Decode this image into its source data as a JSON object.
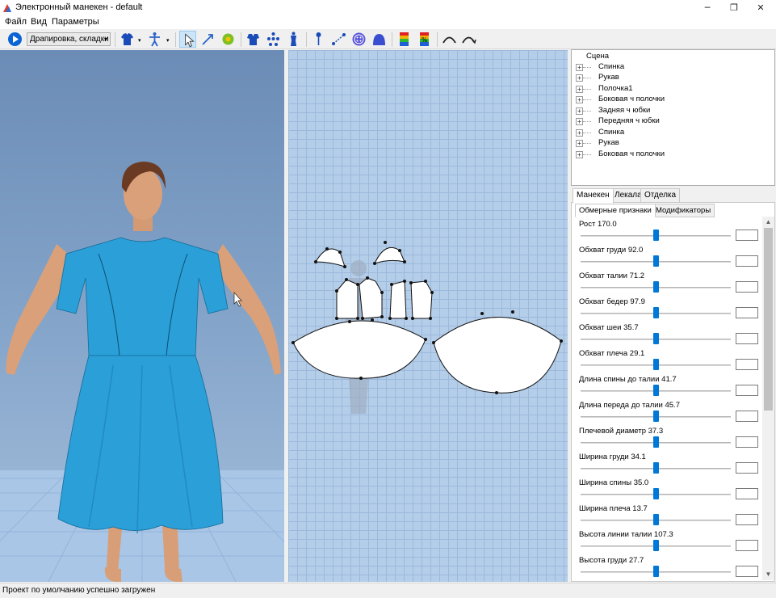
{
  "window": {
    "title": "Электронный манекен - default",
    "minimize_glyph": "─",
    "maximize_glyph": "❐",
    "close_glyph": "✕"
  },
  "menu": [
    "Файл",
    "Вид",
    "Параметры"
  ],
  "toolbar": {
    "mode_select_value": "Драпировка, складки",
    "dropdown_glyph": "▾",
    "icons": [
      "play-icon",
      "shirt-icon",
      "skeleton-icon",
      "pointer-icon",
      "arrow-tool-icon",
      "flower-icon",
      "garment-icon",
      "points-icon",
      "mannequin-icon",
      "pin-icon",
      "measure-line-icon",
      "button-icon",
      "dome-icon",
      "color-map-icon",
      "percent-map-icon",
      "curve-left-icon",
      "curve-right-icon"
    ]
  },
  "scene_tree": {
    "root": "Сцена",
    "expander_glyph": "+",
    "items": [
      "Спинка",
      "Рукав",
      "Полочка1",
      "Боковая ч полочки",
      "Задняя ч юбки",
      "Передняя ч юбки",
      "Спинка",
      "Рукав",
      "Боковая ч полочки"
    ]
  },
  "tabs": {
    "main": [
      "Манекен",
      "Лекала",
      "Отделка"
    ],
    "selected_main": "Манекен",
    "sub": [
      "Обмерные признаки",
      "Модификаторы"
    ],
    "selected_sub": "Обмерные признаки"
  },
  "measurements": [
    {
      "label": "Рост 170.0"
    },
    {
      "label": "Обхват груди 92.0"
    },
    {
      "label": "Обхват талии 71.2"
    },
    {
      "label": "Обхват бедер 97.9"
    },
    {
      "label": "Обхват шеи 35.7"
    },
    {
      "label": "Обхват плеча 29.1"
    },
    {
      "label": "Длина спины до талии 41.7"
    },
    {
      "label": "Длина переда до талии 45.7"
    },
    {
      "label": "Плечевой диаметр 37.3"
    },
    {
      "label": "Ширина груди 34.1"
    },
    {
      "label": "Ширина спины 35.0"
    },
    {
      "label": "Ширина плеча 13.7"
    },
    {
      "label": "Высота линии талии 107.3"
    },
    {
      "label": "Высота груди 27.7"
    }
  ],
  "scrollbar": {
    "up_glyph": "▲",
    "down_glyph": "▼"
  },
  "status": "Проект по умолчанию успешно загружен",
  "colors": {
    "dress": "#2a9fd8",
    "skin": "#d9a07a",
    "pattern_fill": "#ffffff",
    "accent": "#0078d7"
  }
}
